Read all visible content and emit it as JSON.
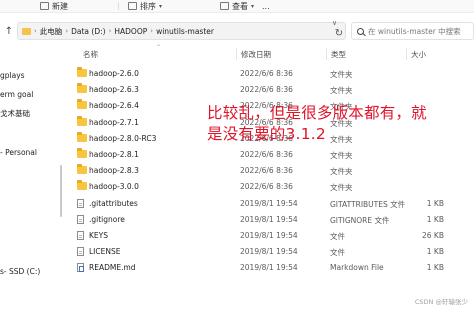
{
  "toolbar": {
    "new_label": "新建",
    "sort_label": "排序",
    "view_label": "查看",
    "more_label": "..."
  },
  "address": {
    "crumbs": [
      "此电脑",
      "Data (D:)",
      "HADOOP",
      "winutils-master"
    ],
    "refresh_glyph": "↻"
  },
  "search": {
    "placeholder": "在 winutils-master 中搜索"
  },
  "sidebar": {
    "items": [
      "gplays",
      "erm goal",
      "戈术基础",
      "- Personal",
      "s- SSD (C:)"
    ]
  },
  "columns": {
    "name": "名称",
    "date": "修改日期",
    "type": "类型",
    "size": "大小"
  },
  "files": [
    {
      "name": "hadoop-2.6.0",
      "date": "2022/6/6 8:36",
      "type": "文件夹",
      "size": "",
      "kind": "folder"
    },
    {
      "name": "hadoop-2.6.3",
      "date": "2022/6/6 8:36",
      "type": "文件夹",
      "size": "",
      "kind": "folder"
    },
    {
      "name": "hadoop-2.6.4",
      "date": "2022/6/6 8:36",
      "type": "文件夹",
      "size": "",
      "kind": "folder"
    },
    {
      "name": "hadoop-2.7.1",
      "date": "2022/6/6 8:36",
      "type": "文件夹",
      "size": "",
      "kind": "folder"
    },
    {
      "name": "hadoop-2.8.0-RC3",
      "date": "2022/6/6 8:36",
      "type": "文件夹",
      "size": "",
      "kind": "folder"
    },
    {
      "name": "hadoop-2.8.1",
      "date": "2022/6/6 8:36",
      "type": "文件夹",
      "size": "",
      "kind": "folder"
    },
    {
      "name": "hadoop-2.8.3",
      "date": "2022/6/6 8:36",
      "type": "文件夹",
      "size": "",
      "kind": "folder"
    },
    {
      "name": "hadoop-3.0.0",
      "date": "2022/6/6 8:36",
      "type": "文件夹",
      "size": "",
      "kind": "folder"
    },
    {
      "name": ".gitattributes",
      "date": "2019/8/1 19:54",
      "type": "GITATTRIBUTES 文件",
      "size": "1 KB",
      "kind": "file"
    },
    {
      "name": ".gitignore",
      "date": "2019/8/1 19:54",
      "type": "GITIGNORE 文件",
      "size": "1 KB",
      "kind": "file"
    },
    {
      "name": "KEYS",
      "date": "2019/8/1 19:54",
      "type": "文件",
      "size": "26 KB",
      "kind": "file"
    },
    {
      "name": "LICENSE",
      "date": "2019/8/1 19:54",
      "type": "文件",
      "size": "1 KB",
      "kind": "file"
    },
    {
      "name": "README.md",
      "date": "2019/8/1 19:54",
      "type": "Markdown File",
      "size": "1 KB",
      "kind": "md"
    }
  ],
  "annotation": {
    "line1": "比较乱，但是很多版本都有，就",
    "line2": "是没有要的3.1.2",
    "color": "#e0152a"
  },
  "watermark": "CSDN @轩辕张少"
}
